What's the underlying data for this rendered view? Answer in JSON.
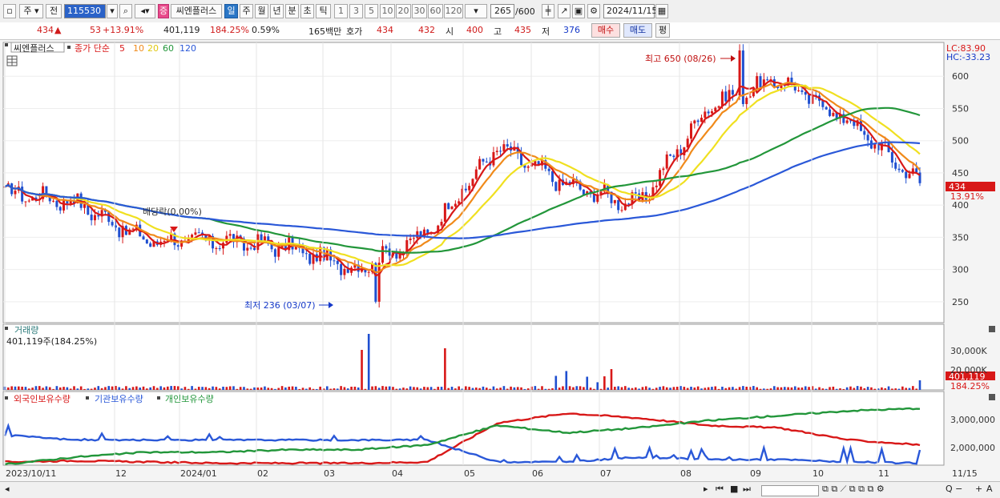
{
  "toolbar": {
    "type_label": "주",
    "type2_label": "전",
    "code": "115530",
    "icon_search": "search-icon",
    "badge": "증",
    "stock_name": "씨엔플러스",
    "periods": [
      "일",
      "주",
      "월",
      "년",
      "분",
      "초",
      "틱"
    ],
    "active_period": "일",
    "intervals": [
      "1",
      "3",
      "5",
      "10",
      "20",
      "30",
      "60",
      "120"
    ],
    "count_value": "265",
    "count_max": "/600",
    "date": "2024/11/15"
  },
  "infobar": {
    "price": "434",
    "arrow": "▲",
    "change": "53",
    "change_pct": "+13.91%",
    "volume": "401,119",
    "volume_pct": "184.25%",
    "turnover": "0.59%",
    "amount": "165백만",
    "quote_label": "호가",
    "bid1": "434",
    "bid2": "432",
    "open_label": "시",
    "open": "400",
    "high_label": "고",
    "high": "435",
    "low_label": "저",
    "low": "376",
    "buy_label": "매수",
    "sell_label": "매도",
    "avg_label": "평"
  },
  "price_panel": {
    "legend_name": "씨엔플러스",
    "legend_ma_title": "종가 단순",
    "ma_periods": [
      "5",
      "10",
      "20",
      "60",
      "120"
    ],
    "ma_colors": [
      "#d81818",
      "#f08a1a",
      "#f0e020",
      "#22963a",
      "#2a58d8"
    ],
    "lc": "LC:83.90",
    "hc": "HC:-33.23",
    "y_ticks": [
      "600",
      "550",
      "500",
      "450",
      "400",
      "350",
      "300",
      "250"
    ],
    "current_price_tag": "434",
    "current_pct_tag": "13.91%",
    "high_note": "최고 650 (08/26)",
    "low_note": "최저 236 (03/07)",
    "dividend_note": "배당락(0.00%)"
  },
  "volume_panel": {
    "title": "거래량",
    "value": "401,119주(184.25%)",
    "y_ticks": [
      "30,000K",
      "20,000K",
      "10,000K"
    ],
    "tag_value": "401,119",
    "tag_pct": "184.25%"
  },
  "holding_panel": {
    "series_labels": [
      "외국인보유수량",
      "기관보유수량",
      "개인보유수량"
    ],
    "series_colors": [
      "#d81818",
      "#2a58d8",
      "#22963a"
    ],
    "y_ticks": [
      "3,000,000",
      "2,000,000"
    ]
  },
  "x_axis": {
    "labels": [
      "2023/10/11",
      "12",
      "2024/01",
      "02",
      "03",
      "04",
      "05",
      "06",
      "07",
      "08",
      "09",
      "10",
      "11"
    ],
    "end_label": "11/15"
  },
  "chart_data": {
    "type": "line",
    "title": "씨엔플러스",
    "x": [
      "2023/10",
      "2023/11",
      "2023/12",
      "2024/01",
      "2024/02",
      "2024/03",
      "2024/04",
      "2024/05",
      "2024/06",
      "2024/07",
      "2024/08",
      "2024/09",
      "2024/10",
      "2024/11/15"
    ],
    "series": [
      {
        "name": "씨엔플러스",
        "values": [
          420,
          405,
          345,
          345,
          335,
          300,
          355,
          490,
          430,
          400,
          555,
          595,
          530,
          434
        ]
      }
    ],
    "annotations": [
      "최고 650 (08/26)",
      "최저 236 (03/07)",
      "배당락(0.00%)"
    ],
    "ylim": [
      220,
      650
    ]
  }
}
